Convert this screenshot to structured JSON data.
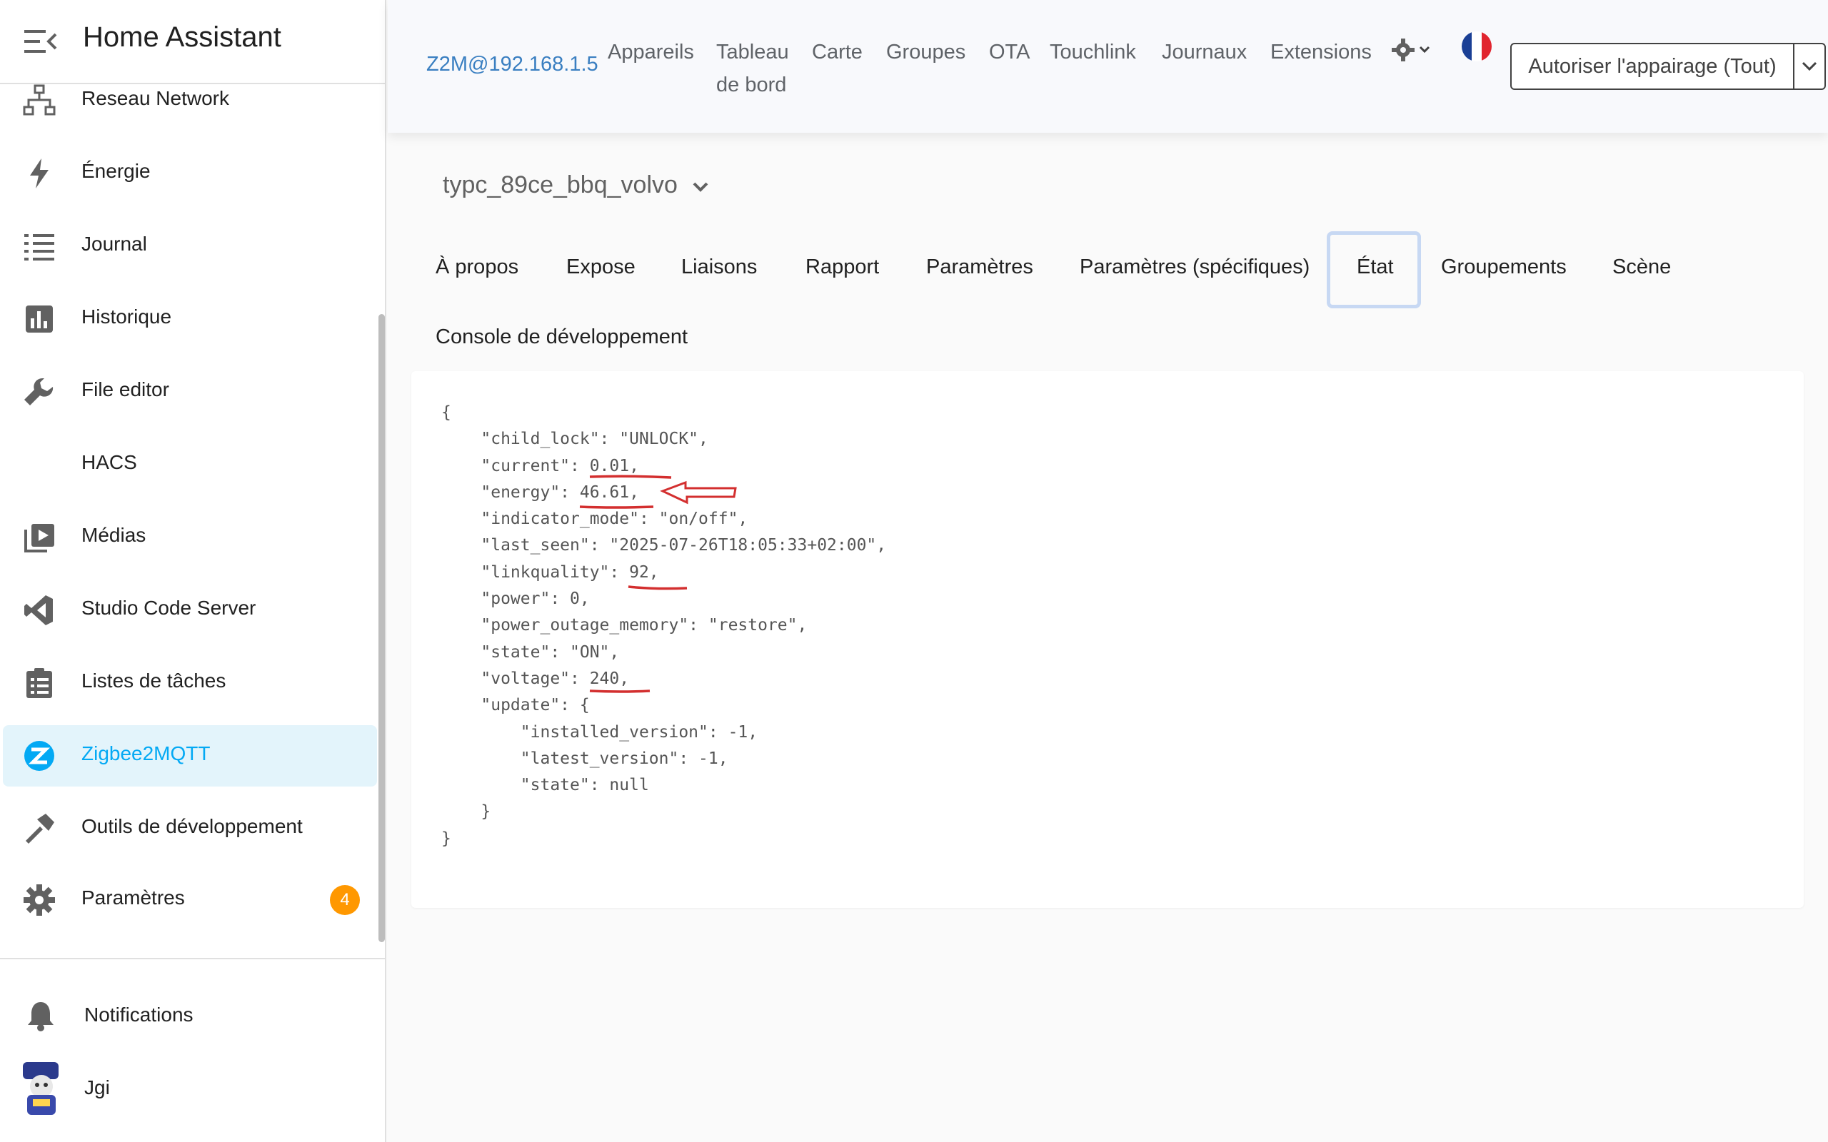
{
  "sidebar": {
    "title": "Home Assistant",
    "items": [
      {
        "label": "Reseau Network",
        "icon": "network-icon"
      },
      {
        "label": "Énergie",
        "icon": "lightning-icon"
      },
      {
        "label": "Journal",
        "icon": "list-icon"
      },
      {
        "label": "Historique",
        "icon": "chart-bar-icon"
      },
      {
        "label": "File editor",
        "icon": "wrench-icon"
      },
      {
        "label": "HACS",
        "icon": ""
      },
      {
        "label": "Médias",
        "icon": "play-box-icon"
      },
      {
        "label": "Studio Code Server",
        "icon": "vscode-icon"
      },
      {
        "label": "Listes de tâches",
        "icon": "clipboard-list-icon"
      },
      {
        "label": "Zigbee2MQTT",
        "icon": "zigbee-icon"
      },
      {
        "label": "Outils de développement",
        "icon": "hammer-icon"
      },
      {
        "label": "Paramètres",
        "icon": "gear-icon",
        "badge": "4"
      }
    ],
    "notifications_label": "Notifications",
    "user_name": "Jgi"
  },
  "topnav": {
    "brand": "Z2M@192.168.1.5",
    "items": [
      "Appareils",
      "Tableau",
      "de bord",
      "Carte",
      "Groupes",
      "OTA",
      "Touchlink",
      "Journaux",
      "Extensions"
    ],
    "pair_button": "Autoriser l'appairage (Tout)"
  },
  "device": {
    "name": "typc_89ce_bbq_volvo"
  },
  "tabs": [
    "À propos",
    "Expose",
    "Liaisons",
    "Rapport",
    "Paramètres",
    "Paramètres (spécifiques)",
    "État",
    "Groupements",
    "Scène",
    "Console de développement"
  ],
  "active_tab": "État",
  "state_json": {
    "lines": [
      "{",
      "    \"child_lock\": \"UNLOCK\",",
      "    \"current\": 0.01,",
      "    \"energy\": 46.61,",
      "    \"indicator_mode\": \"on/off\",",
      "    \"last_seen\": \"2025-07-26T18:05:33+02:00\",",
      "    \"linkquality\": 92,",
      "    \"power\": 0,",
      "    \"power_outage_memory\": \"restore\",",
      "    \"state\": \"ON\",",
      "    \"voltage\": 240,",
      "    \"update\": {",
      "        \"installed_version\": -1,",
      "        \"latest_version\": -1,",
      "        \"state\": null",
      "    }",
      "}"
    ]
  },
  "colors": {
    "accent": "#03a9f4",
    "brand_link": "#3a7fc1",
    "badge": "#ff9800",
    "annotation": "#d32f2f"
  }
}
